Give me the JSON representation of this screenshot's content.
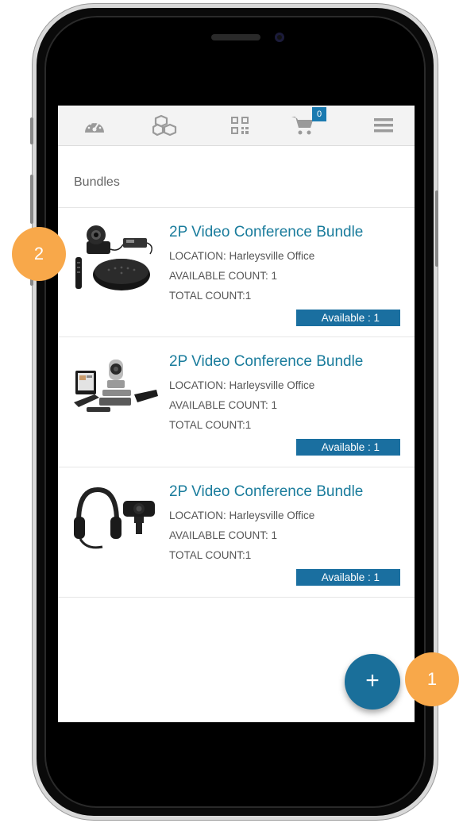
{
  "nav": {
    "icons": [
      "dashboard-icon",
      "cubes-icon",
      "qr-code-icon",
      "cart-icon",
      "menu-icon"
    ],
    "cart_count": "0"
  },
  "section_title": "Bundles",
  "items": [
    {
      "title": "2P Video Conference Bundle",
      "location": "LOCATION: Harleysville Office",
      "available_count": "AVAILABLE COUNT: 1",
      "total_count": "TOTAL COUNT:1",
      "badge": "Available : 1"
    },
    {
      "title": "2P Video Conference Bundle",
      "location": "LOCATION: Harleysville Office",
      "available_count": "AVAILABLE COUNT: 1",
      "total_count": "TOTAL COUNT:1",
      "badge": "Available : 1"
    },
    {
      "title": "2P Video Conference Bundle",
      "location": "LOCATION: Harleysville Office",
      "available_count": "AVAILABLE COUNT: 1",
      "total_count": "TOTAL COUNT:1",
      "badge": "Available : 1"
    }
  ],
  "fab_label": "+",
  "callouts": {
    "one": "1",
    "two": "2"
  },
  "colors": {
    "accent": "#1a7c9c",
    "badge": "#1a6fa0",
    "callout": "#f8a84a"
  }
}
